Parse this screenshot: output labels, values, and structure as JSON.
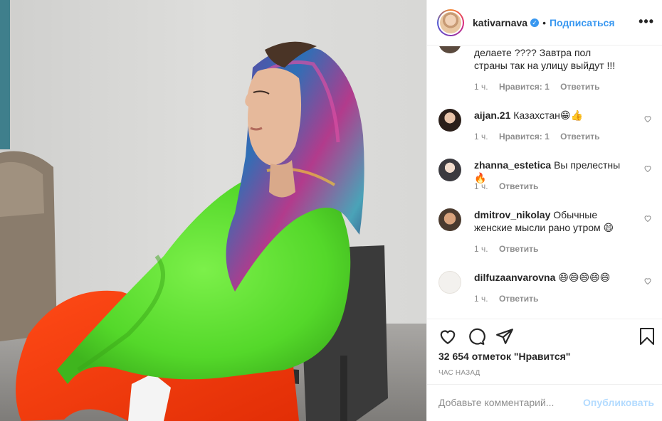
{
  "colors": {
    "accent": "#3897f0",
    "muted": "#8e8e8e",
    "publish_disabled": "#b3dbff",
    "divider": "#efefef"
  },
  "photo": {
    "icon": "post-photo"
  },
  "header": {
    "username": "kativarnava",
    "separator": "•",
    "follow_label": "Подписаться",
    "more_label": "•••"
  },
  "comments": [
    {
      "username": "",
      "text": "делаете ???? Завтра пол страны так на улицу выйдут !!!",
      "time": "1 ч.",
      "likes": "Нравится: 1",
      "reply": "Ответить"
    },
    {
      "username": "aijan.21",
      "text": "Казахстан😁👍",
      "time": "1 ч.",
      "likes": "Нравится: 1",
      "reply": "Ответить"
    },
    {
      "username": "zhanna_estetica",
      "text": "Вы прелестны🔥",
      "time": "1 ч.",
      "reply": "Ответить"
    },
    {
      "username": "dmitrov_nikolay",
      "text": "Обычные женские мысли рано утром 😄",
      "time": "1 ч.",
      "reply": "Ответить"
    },
    {
      "username": "dilfuzaanvarovna",
      "text": "😄😄😄😄😄",
      "time": "1 ч.",
      "reply": "Ответить"
    }
  ],
  "actions": {
    "like_icon": "heart-icon",
    "comment_icon": "comment-icon",
    "share_icon": "share-icon",
    "save_icon": "bookmark-icon"
  },
  "likes_count": "32 654 отметок \"Нравится\"",
  "timestamp": "ЧАС НАЗАД",
  "add_comment": {
    "placeholder": "Добавьте комментарий...",
    "publish_label": "Опубликовать"
  }
}
